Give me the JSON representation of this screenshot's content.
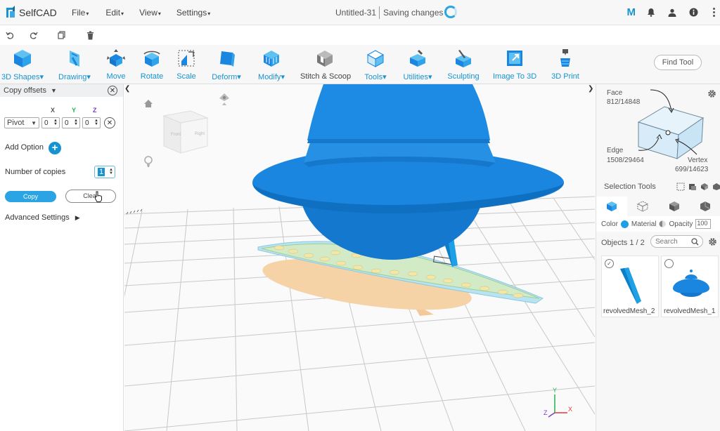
{
  "app": {
    "name": "SelfCAD",
    "menus": [
      "File",
      "Edit",
      "View",
      "Settings"
    ],
    "document_title": "Untitled-31",
    "save_status": "Saving changes",
    "user_badge": "M"
  },
  "ribbon": {
    "tools": [
      {
        "label": "3D Shapes",
        "icon": "cube-icon",
        "dropdown": true
      },
      {
        "label": "Drawing",
        "icon": "drawing-icon",
        "dropdown": true
      },
      {
        "label": "Move",
        "icon": "move-icon",
        "dropdown": false
      },
      {
        "label": "Rotate",
        "icon": "rotate-icon",
        "dropdown": false
      },
      {
        "label": "Scale",
        "icon": "scale-icon",
        "dropdown": false
      },
      {
        "label": "Deform",
        "icon": "deform-icon",
        "dropdown": true
      },
      {
        "label": "Modify",
        "icon": "modify-icon",
        "dropdown": true
      },
      {
        "label": "Stitch & Scoop",
        "icon": "stitch-scoop-icon",
        "dropdown": false
      },
      {
        "label": "Tools",
        "icon": "tools-icon",
        "dropdown": true
      },
      {
        "label": "Utilities",
        "icon": "utilities-icon",
        "dropdown": true
      },
      {
        "label": "Sculpting",
        "icon": "sculpting-icon",
        "dropdown": false
      },
      {
        "label": "Image To 3D",
        "icon": "image-to-3d-icon",
        "dropdown": false
      },
      {
        "label": "3D Print",
        "icon": "3d-print-icon",
        "dropdown": false
      }
    ],
    "find_tool": "Find Tool"
  },
  "left_panel": {
    "title": "Copy offsets",
    "axes": [
      "X",
      "Y",
      "Z"
    ],
    "axis_colors": [
      "#555555",
      "#22b24c",
      "#7a3cc8"
    ],
    "pivot": "Pivot",
    "offsets": [
      "0",
      "0",
      "0"
    ],
    "add_option": "Add Option",
    "number_of_copies_label": "Number of copies",
    "number_of_copies": "1",
    "copy_button": "Copy",
    "clear_button": "Clear",
    "advanced_settings": "Advanced Settings"
  },
  "viewport": {
    "view_cube_front": "Front",
    "view_cube_right": "Right",
    "axis_y": "Y",
    "axis_z": "Z",
    "axis_x": "X"
  },
  "right_panel": {
    "face_label": "Face",
    "face_value": "812/14848",
    "edge_label": "Edge",
    "edge_value": "1508/29464",
    "vertex_label": "Vertex",
    "vertex_value": "699/14623",
    "selection_tools": "Selection Tools",
    "color_label": "Color",
    "material_label": "Material",
    "opacity_label": "Opacity",
    "opacity_value": "100",
    "objects_label": "Objects 1 / 2",
    "search_placeholder": "Search",
    "objects": [
      {
        "name": "revolvedMesh_2",
        "checked": true
      },
      {
        "name": "revolvedMesh_1",
        "checked": false
      }
    ]
  },
  "colors": {
    "accent": "#1793d1",
    "model_blue": "#1a86e0"
  }
}
